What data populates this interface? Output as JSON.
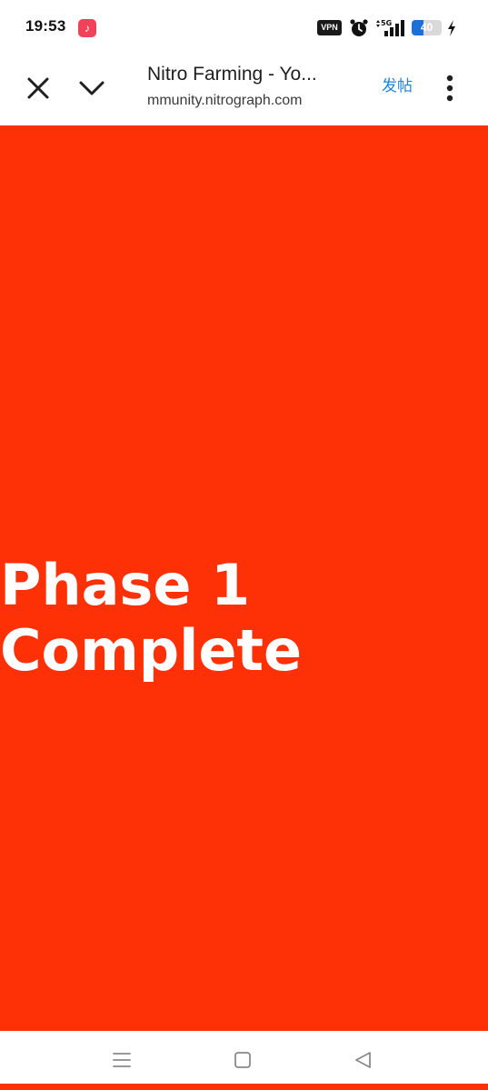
{
  "status_bar": {
    "time": "19:53",
    "music_glyph": "♪",
    "vpn_label": "VPN",
    "network_label": "5G",
    "battery_level": 40,
    "battery_text": "40",
    "icons": [
      "music-app-icon",
      "alarm-icon",
      "signal-icon",
      "battery-icon",
      "charging-icon"
    ]
  },
  "toolbar": {
    "title": "Nitro Farming - Yo...",
    "url": "mmunity.nitrograph.com",
    "post_label": "发帖",
    "icons": [
      "close-icon",
      "chevron-down-icon",
      "more-vertical-icon"
    ]
  },
  "content": {
    "headline_line1": "Phase 1",
    "headline_line2": "Complete",
    "background_color": "#fd3105"
  },
  "nav_bar": {
    "icons": [
      "recents-menu-icon",
      "home-square-icon",
      "back-triangle-icon"
    ]
  },
  "colors": {
    "accent": "#1a86d6",
    "battery_fill": "#1f6fd8"
  }
}
